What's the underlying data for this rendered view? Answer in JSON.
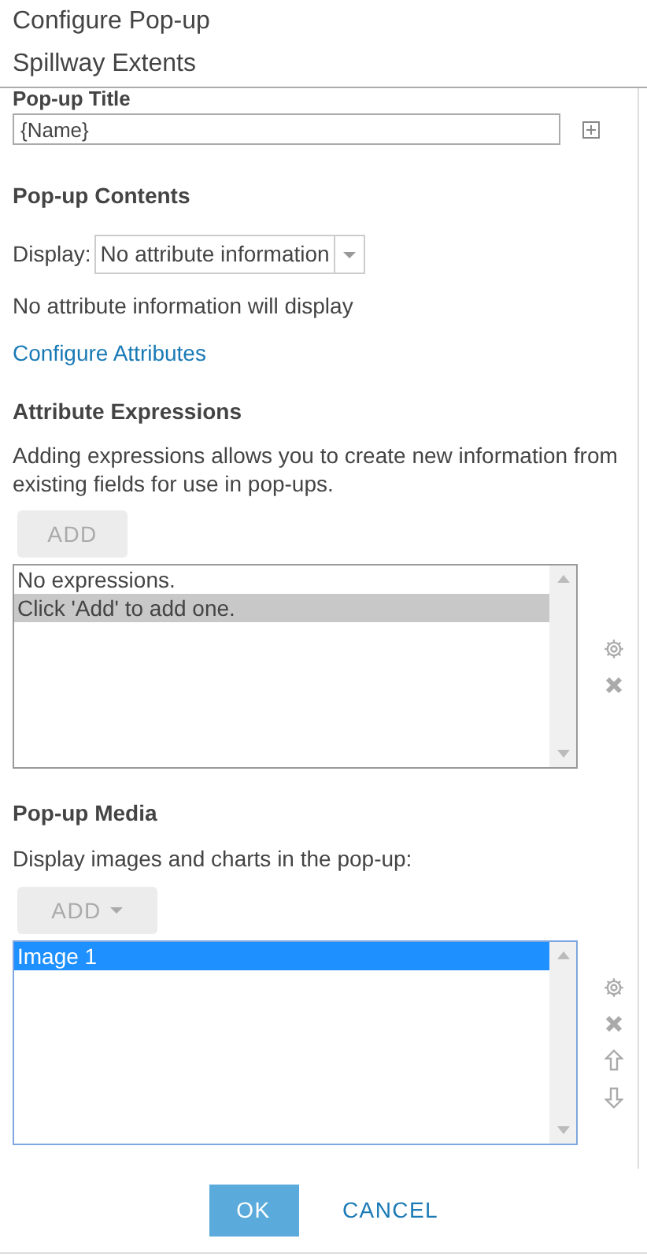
{
  "window": {
    "title": "Configure Pop-up",
    "subtitle": "Spillway Extents"
  },
  "popup_title": {
    "label": "Pop-up Title",
    "value": "{Name}"
  },
  "contents": {
    "heading": "Pop-up Contents",
    "display_label": "Display:",
    "display_value": "No attribute information",
    "note": "No attribute information will display",
    "link": "Configure Attributes"
  },
  "expressions": {
    "heading": "Attribute Expressions",
    "description": "Adding expressions allows you to create new information from existing fields for use in pop-ups.",
    "add_button": "ADD",
    "items": [
      {
        "text": "No expressions.",
        "selected": false
      },
      {
        "text": "Click 'Add' to add one.",
        "selected": true
      }
    ]
  },
  "media": {
    "heading": "Pop-up Media",
    "description": "Display images and charts in the pop-up:",
    "add_button": "ADD",
    "items": [
      {
        "text": "Image 1",
        "selected": true
      }
    ]
  },
  "buttons": {
    "ok": "OK",
    "cancel": "CANCEL"
  }
}
